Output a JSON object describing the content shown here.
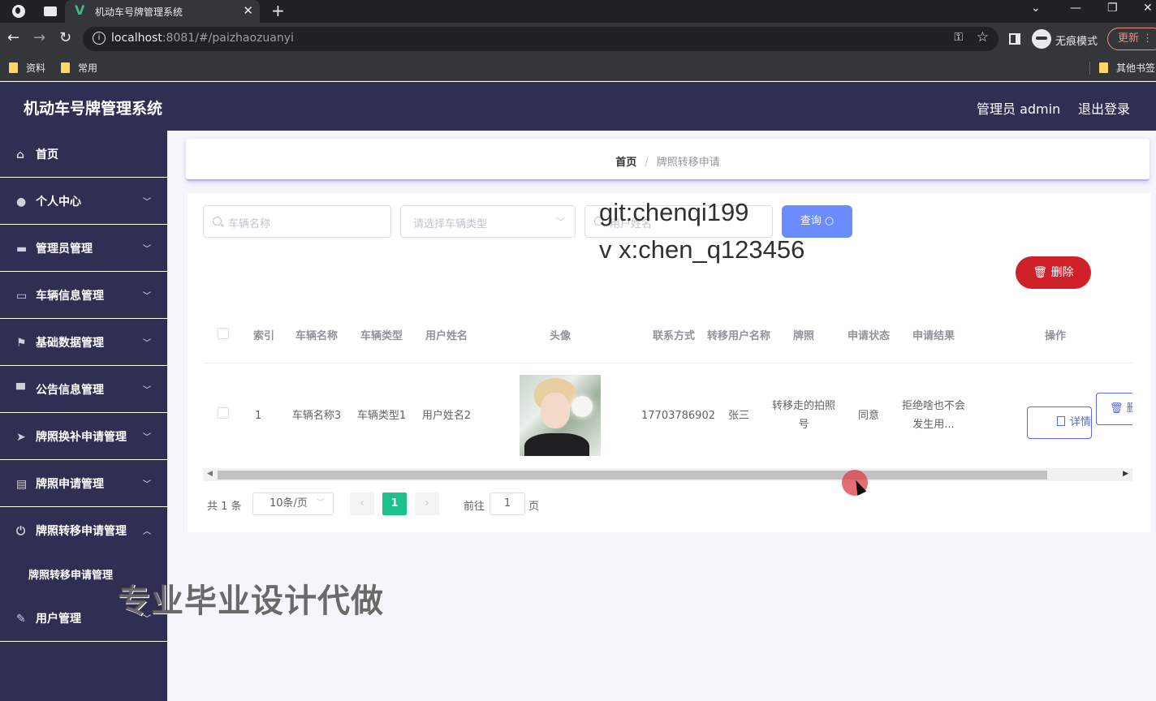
{
  "browser": {
    "tab_title": "机动车号牌管理系统",
    "url_host": "localhost",
    "url_path": ":8081/#/paizhaozuanyi",
    "incognito_label": "无痕模式",
    "update_label": "更新",
    "bookmarks": [
      "资料",
      "常用"
    ],
    "other_bookmarks": "其他书签"
  },
  "header": {
    "title": "机动车号牌管理系统",
    "user": "管理员 admin",
    "logout": "退出登录"
  },
  "sidebar": {
    "items": [
      {
        "label": "首页"
      },
      {
        "label": "个人中心"
      },
      {
        "label": "管理员管理"
      },
      {
        "label": "车辆信息管理"
      },
      {
        "label": "基础数据管理"
      },
      {
        "label": "公告信息管理"
      },
      {
        "label": "牌照换补申请管理"
      },
      {
        "label": "牌照申请管理"
      },
      {
        "label": "牌照转移申请管理"
      },
      {
        "label": "用户管理"
      }
    ],
    "submenu_active": "牌照转移申请管理"
  },
  "breadcrumb": {
    "home": "首页",
    "separator": "/",
    "current": "牌照转移申请"
  },
  "search": {
    "vehicle_name_placeholder": "车辆名称",
    "vehicle_type_placeholder": "请选择车辆类型",
    "third_placeholder": "用户姓名",
    "query_label": "查询"
  },
  "toolbar": {
    "delete_label": "删除"
  },
  "table": {
    "headers": [
      "索引",
      "车辆名称",
      "车辆类型",
      "用户姓名",
      "头像",
      "联系方式",
      "转移用户名称",
      "牌照",
      "申请状态",
      "申请结果",
      "操作"
    ],
    "rows": [
      {
        "index": "1",
        "vehicle_name": "车辆名称3",
        "vehicle_type": "车辆类型1",
        "user_name": "用户姓名2",
        "phone": "17703786902",
        "transfer_user": "张三",
        "plate": "转移走的拍照号",
        "status": "同意",
        "result": "拒绝啥也不会发生用...",
        "detail_label": "详情",
        "delete_label": "删"
      }
    ]
  },
  "pagination": {
    "total": "共 1 条",
    "page_size": "10条/页",
    "current_page": "1",
    "goto_label": "前往",
    "goto_value": "1",
    "page_unit": "页"
  },
  "overlay": {
    "line1": "git:chenqi199",
    "line2": "v x:chen_q123456",
    "line3": "专业毕业设计代做"
  }
}
